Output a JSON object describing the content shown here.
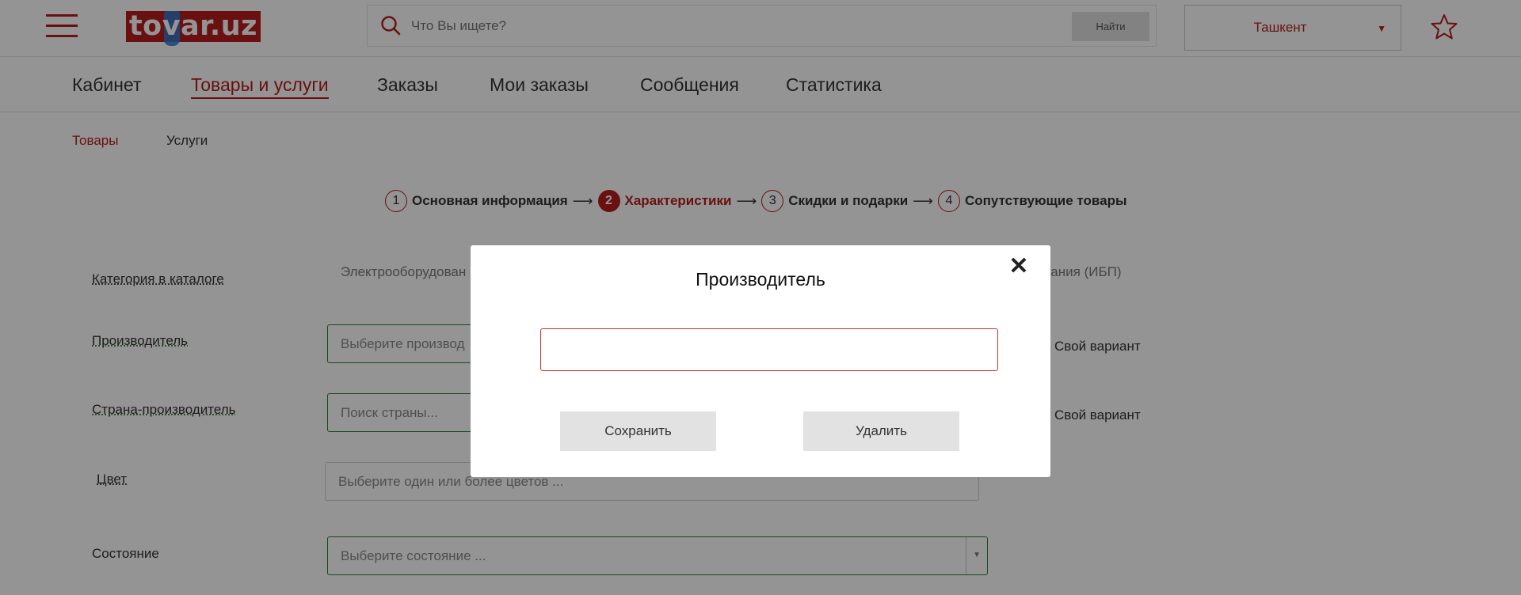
{
  "header": {
    "logo_text": "tovar.uz",
    "search_placeholder": "Что Вы ищете?",
    "search_button": "Найти",
    "city": "Ташкент"
  },
  "nav": {
    "items": [
      {
        "label": "Кабинет"
      },
      {
        "label": "Товары и услуги",
        "active": true
      },
      {
        "label": "Заказы"
      },
      {
        "label": "Мои заказы"
      },
      {
        "label": "Сообщения"
      },
      {
        "label": "Статистика"
      }
    ]
  },
  "subtabs": {
    "goods": "Товары",
    "services": "Услуги"
  },
  "steps": [
    {
      "num": "1",
      "label": "Основная информация"
    },
    {
      "num": "2",
      "label": "Характеристики",
      "active": true
    },
    {
      "num": "3",
      "label": "Скидки и подарки"
    },
    {
      "num": "4",
      "label": "Сопутствующие товары"
    }
  ],
  "form": {
    "category_label": "Категория в каталоге",
    "category_value_start": "Электрооборудован",
    "category_value_end": "питания (ИБП)",
    "manufacturer_label": "Производитель",
    "manufacturer_placeholder": "Выберите производ",
    "own_variant": "Свой вариант",
    "country_label": "Страна-производитель",
    "country_placeholder": "Поиск страны...",
    "own_variant_2": "Свой вариант",
    "color_label": "Цвет",
    "color_placeholder": "Выберите один или более цветов ...",
    "condition_label": "Состояние",
    "condition_placeholder": "Выберите состояние ..."
  },
  "modal": {
    "title": "Производитель",
    "input_value": "",
    "save": "Сохранить",
    "delete": "Удалить"
  },
  "colors": {
    "brand_red": "#b71c1c",
    "field_green": "#2e7d32"
  }
}
